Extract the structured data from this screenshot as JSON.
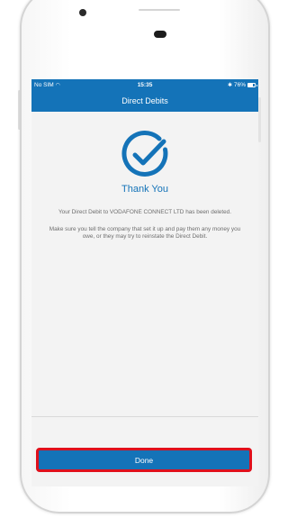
{
  "status_bar": {
    "carrier": "No SIM",
    "time": "15:35",
    "battery": "76%",
    "battery_level": 0.76
  },
  "nav": {
    "title": "Direct Debits"
  },
  "content": {
    "icon": "check-circle-icon",
    "heading": "Thank You",
    "message": "Your Direct Debit to VODAFONE CONNECT LTD has been deleted.",
    "advice": "Make sure you tell the company that set it up and pay them any money you owe, or they may try to reinstate the Direct Debit."
  },
  "actions": {
    "done_label": "Done"
  },
  "colors": {
    "brand_blue": "#1473b8",
    "highlight_red": "#e0101c",
    "background": "#f3f3f3"
  }
}
